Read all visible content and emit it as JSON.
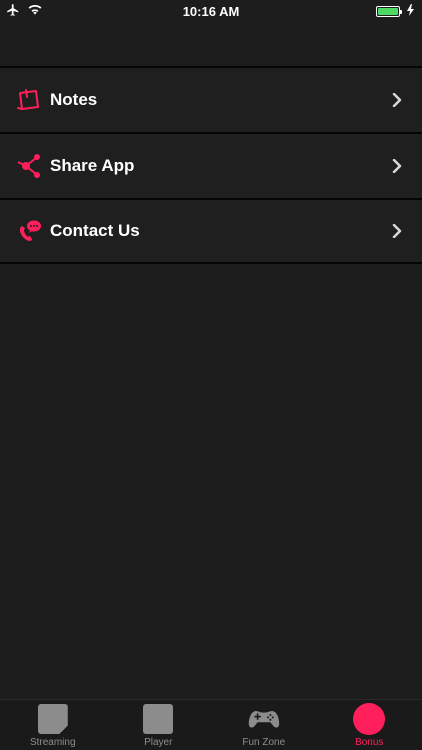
{
  "status_bar": {
    "time": "10:16 AM",
    "battery_level": 1.0,
    "battery_color": "#4cd964"
  },
  "menu": {
    "items": [
      {
        "label": "Notes",
        "icon": "notes-icon"
      },
      {
        "label": "Share App",
        "icon": "share-icon"
      },
      {
        "label": "Contact Us",
        "icon": "contact-phone-icon"
      }
    ]
  },
  "tab_bar": {
    "tabs": [
      {
        "label": "Streaming",
        "icon": "streaming-icon",
        "active": false
      },
      {
        "label": "Player",
        "icon": "player-icon",
        "active": false
      },
      {
        "label": "Fun Zone",
        "icon": "gamepad-icon",
        "active": false
      },
      {
        "label": "Bonus",
        "icon": "bonus-icon",
        "active": true
      }
    ]
  },
  "colors": {
    "accent": "#ff1f5a",
    "background": "#1d1d1d",
    "inactive": "#8e8e8e"
  }
}
